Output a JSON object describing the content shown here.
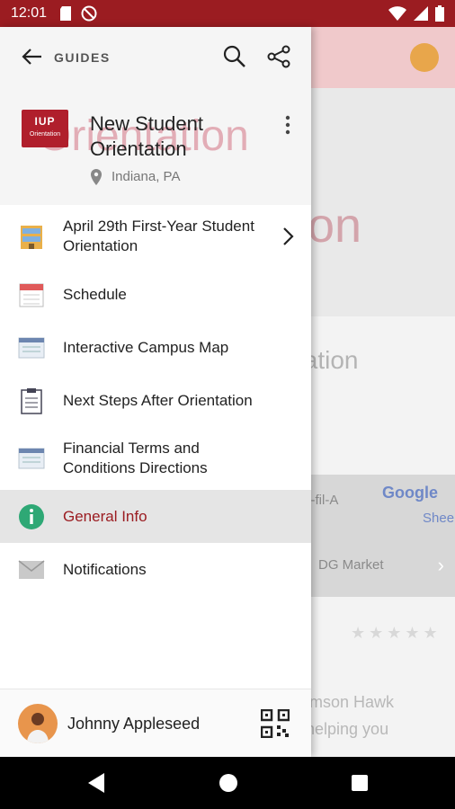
{
  "status_bar": {
    "time": "12:01"
  },
  "background": {
    "hero_text": "ion",
    "sub_text": "tation",
    "map_google": "Google",
    "map_text_1": "k-fil-A",
    "map_text_2": "DG Market",
    "map_text_3": "Shee",
    "stars": "★★★★★",
    "text_line_1": "imson Hawk",
    "text_line_2": "helping you"
  },
  "drawer": {
    "guides_label": "GUIDES",
    "header_watermark": "Orientation",
    "logo_top": "IUP",
    "logo_bottom": "Orientation",
    "title": "New Student Orientation",
    "location": "Indiana, PA",
    "menu": [
      {
        "label": "April 29th First-Year Student Orientation",
        "icon": "building-icon"
      },
      {
        "label": "Schedule",
        "icon": "calendar-icon"
      },
      {
        "label": "Interactive Campus Map",
        "icon": "map-icon"
      },
      {
        "label": "Next Steps After Orientation",
        "icon": "clipboard-icon"
      },
      {
        "label": "Financial Terms and Conditions Directions",
        "icon": "map-icon"
      },
      {
        "label": "General Info",
        "icon": "info-icon"
      },
      {
        "label": "Notifications",
        "icon": "envelope-icon"
      }
    ],
    "user_name": "Johnny Appleseed"
  },
  "colors": {
    "brand": "#9b1c21",
    "info_green": "#2ea875"
  }
}
